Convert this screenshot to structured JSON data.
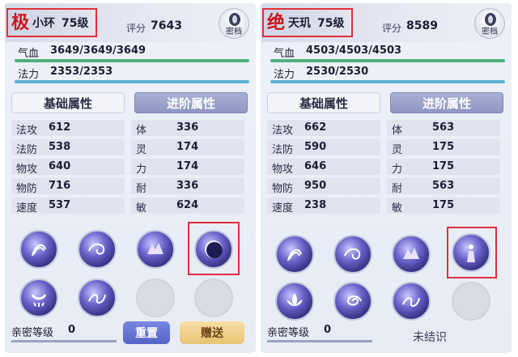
{
  "left": {
    "class_glyph": "极",
    "name": "小环",
    "level": "75级",
    "score_label": "评分",
    "score_value": "7643",
    "secret_label": "密档",
    "hp_label": "气血",
    "hp_value": "3649/3649/3649",
    "mp_label": "法力",
    "mp_value": "2353/2353",
    "tab_base": "基础属性",
    "tab_advanced": "进阶属性",
    "attrs_left": [
      {
        "k": "法攻",
        "v": "612"
      },
      {
        "k": "法防",
        "v": "538"
      },
      {
        "k": "物攻",
        "v": "640"
      },
      {
        "k": "物防",
        "v": "716"
      },
      {
        "k": "速度",
        "v": "537"
      }
    ],
    "attrs_right": [
      {
        "k": "体",
        "v": "336"
      },
      {
        "k": "灵",
        "v": "174"
      },
      {
        "k": "力",
        "v": "174"
      },
      {
        "k": "耐",
        "v": "336"
      },
      {
        "k": "敏",
        "v": "624"
      }
    ],
    "intimacy_label": "亲密等级",
    "intimacy_value": "0",
    "reset_label": "重置",
    "gift_label": "赠送"
  },
  "right": {
    "class_glyph": "绝",
    "name": "天玑",
    "level": "75级",
    "score_label": "评分",
    "score_value": "8589",
    "secret_label": "密档",
    "hp_label": "气血",
    "hp_value": "4503/4503/4503",
    "mp_label": "法力",
    "mp_value": "2530/2530",
    "tab_base": "基础属性",
    "tab_advanced": "进阶属性",
    "attrs_left": [
      {
        "k": "法攻",
        "v": "662"
      },
      {
        "k": "法防",
        "v": "590"
      },
      {
        "k": "物攻",
        "v": "646"
      },
      {
        "k": "物防",
        "v": "950"
      },
      {
        "k": "速度",
        "v": "238"
      }
    ],
    "attrs_right": [
      {
        "k": "体",
        "v": "563"
      },
      {
        "k": "灵",
        "v": "175"
      },
      {
        "k": "力",
        "v": "175"
      },
      {
        "k": "耐",
        "v": "563"
      },
      {
        "k": "敏",
        "v": "175"
      }
    ],
    "intimacy_label": "亲密等级",
    "intimacy_value": "0",
    "unbound_label": "未结识"
  },
  "colors": {
    "highlight": "#e0303a",
    "class_glyph": "#c9161f",
    "hp_bar": "#4fb07a",
    "mp_bar": "#5fb1d6",
    "skill_base": "#6a62c9"
  },
  "icons": {
    "left_skills": [
      "swirl-claw-icon",
      "spiral-wind-icon",
      "beast-icon",
      "crescent-moon-icon",
      "crescent-arc-icon",
      "wave-dragon-icon"
    ],
    "right_skills": [
      "swirl-claw-icon",
      "spiral-wind-icon",
      "beast-icon",
      "praying-figure-icon",
      "lotus-icon",
      "swirl-icon",
      "wave-dragon-icon"
    ]
  }
}
